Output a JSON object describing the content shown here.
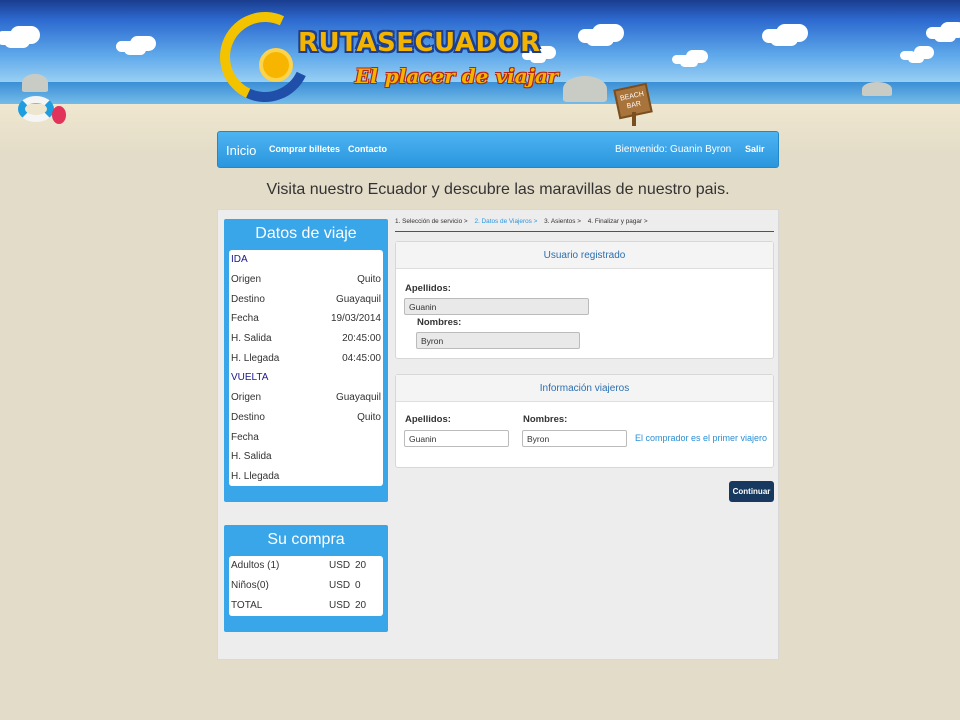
{
  "header": {
    "logo_title": "RUTASECUADOR",
    "logo_slogan": "El placer de viajar",
    "beach_sign": "BEACH BAR"
  },
  "nav": {
    "home": "Inicio",
    "buy_tickets": "Comprar billetes",
    "contact": "Contacto",
    "welcome": "Bienvenido: Guanin Byron",
    "logout": "Salir"
  },
  "tagline": "Visita nuestro Ecuador y descubre las maravillas de nuestro pais.",
  "trip": {
    "title": "Datos de viaje",
    "outbound_label": "IDA",
    "return_label": "VUELTA",
    "outbound": [
      {
        "label": "Origen",
        "value": "Quito"
      },
      {
        "label": "Destino",
        "value": "Guayaquil"
      },
      {
        "label": "Fecha",
        "value": "19/03/2014"
      },
      {
        "label": "H. Salida",
        "value": "20:45:00"
      },
      {
        "label": "H. Llegada",
        "value": "04:45:00"
      }
    ],
    "return": [
      {
        "label": "Origen",
        "value": "Guayaquil"
      },
      {
        "label": "Destino",
        "value": "Quito"
      },
      {
        "label": "Fecha",
        "value": ""
      },
      {
        "label": "H. Salida",
        "value": ""
      },
      {
        "label": "H. Llegada",
        "value": ""
      }
    ]
  },
  "purchase": {
    "title": "Su compra",
    "rows": [
      {
        "label": "Adultos (1)",
        "currency": "USD",
        "amount": "20"
      },
      {
        "label": "Niños(0)",
        "currency": "USD",
        "amount": "0"
      },
      {
        "label": "TOTAL",
        "currency": "USD",
        "amount": "20"
      }
    ]
  },
  "steps": {
    "step1": "1. Selección de servicio >",
    "step2": "2. Datos de Viajeros >",
    "step3": "3. Asientos >",
    "step4": "4. Finalizar y pagar >"
  },
  "registered": {
    "title": "Usuario registrado",
    "last_name_label": "Apellidos:",
    "last_name_value": "Guanin",
    "first_name_label": "Nombres:",
    "first_name_value": "Byron"
  },
  "travelers": {
    "title": "Información viajeros",
    "last_name_label": "Apellidos:",
    "last_name_value": "Guanin",
    "first_name_label": "Nombres:",
    "first_name_value": "Byron",
    "buyer_link": "El comprador es el primer viajero"
  },
  "continue_button": "Continuar",
  "colors": {
    "accent": "#2a96de",
    "button": "#17395f",
    "sidebar": "#39a6ea"
  }
}
